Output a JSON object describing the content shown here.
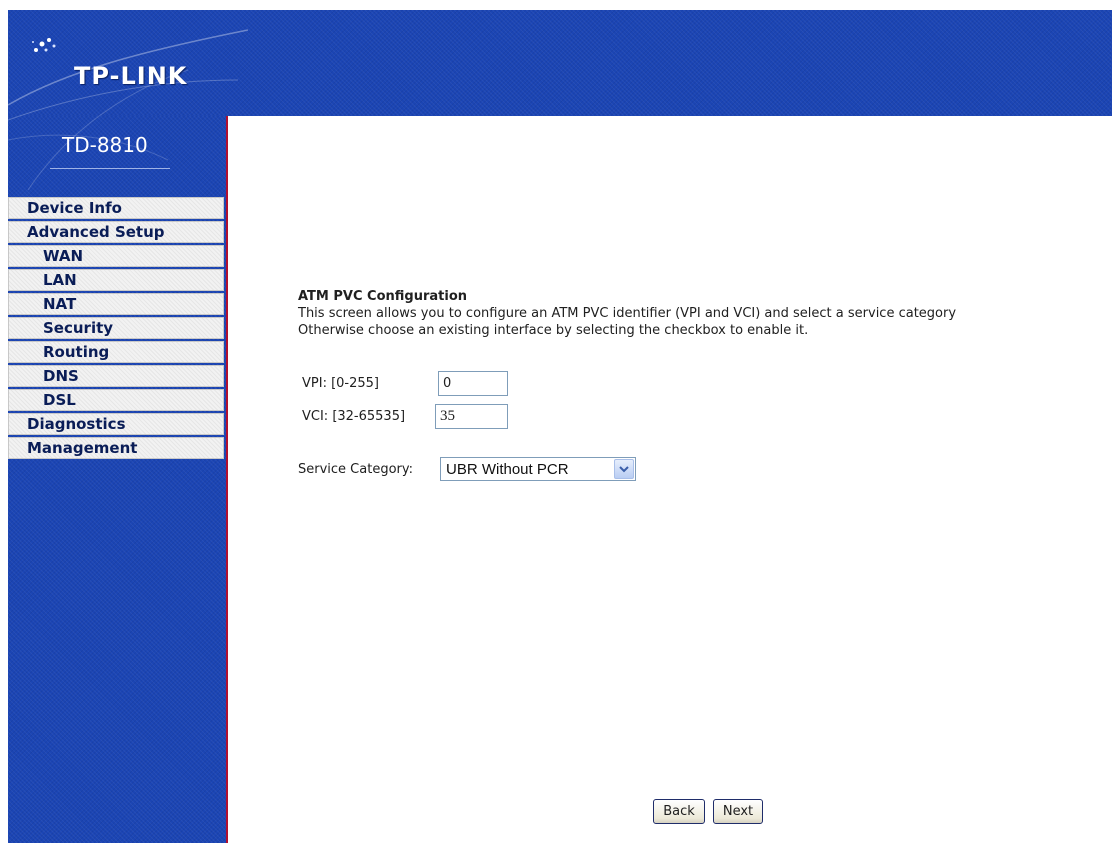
{
  "brand": {
    "logo_text": "TP-LINK",
    "model": "TD-8810"
  },
  "nav": {
    "items": [
      {
        "label": "Device Info",
        "level": "top"
      },
      {
        "label": "Advanced Setup",
        "level": "top"
      },
      {
        "label": "WAN",
        "level": "sub"
      },
      {
        "label": "LAN",
        "level": "sub"
      },
      {
        "label": "NAT",
        "level": "sub"
      },
      {
        "label": "Security",
        "level": "sub"
      },
      {
        "label": "Routing",
        "level": "sub"
      },
      {
        "label": "DNS",
        "level": "sub"
      },
      {
        "label": "DSL",
        "level": "sub"
      },
      {
        "label": "Diagnostics",
        "level": "top"
      },
      {
        "label": "Management",
        "level": "top"
      }
    ]
  },
  "main": {
    "title": "ATM PVC Configuration",
    "description_line1": "This screen allows you to configure an ATM PVC identifier (VPI and VCI) and select a service category",
    "description_line2": "Otherwise choose an existing interface by selecting the checkbox to enable it.",
    "vpi": {
      "label": "VPI: [0-255]",
      "value": "0"
    },
    "vci": {
      "label": "VCI: [32-65535]",
      "value": "35"
    },
    "service_category": {
      "label": "Service Category:",
      "selected": "UBR Without PCR"
    },
    "buttons": {
      "back": "Back",
      "next": "Next"
    }
  },
  "colors": {
    "brand_blue": "#1b45b4",
    "accent_red": "#b01030",
    "nav_text": "#0a1d57"
  },
  "icons": {
    "select_arrow": "chevron-down-icon",
    "logo_mark": "sparkle-icon"
  }
}
